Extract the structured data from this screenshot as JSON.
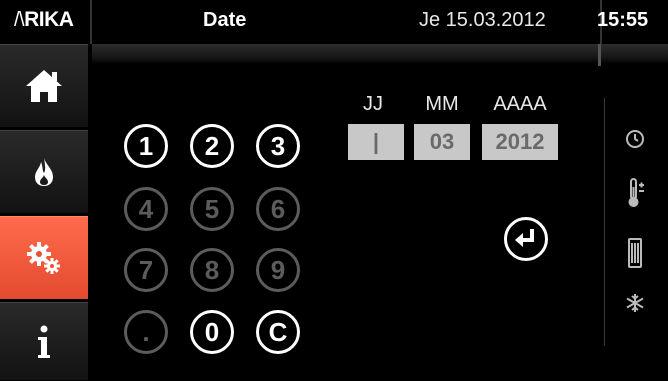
{
  "app": {
    "logo_text": "RIKA",
    "title": "Date",
    "date": "Je 15.03.2012",
    "time": "15:55"
  },
  "sidebar": {
    "items": [
      {
        "icon": "home-icon"
      },
      {
        "icon": "flame-icon"
      },
      {
        "icon": "settings-gears-icon",
        "active": true
      },
      {
        "icon": "info-icon"
      }
    ]
  },
  "keypad": {
    "keys": [
      {
        "label": "1",
        "enabled": true
      },
      {
        "label": "2",
        "enabled": true
      },
      {
        "label": "3",
        "enabled": true
      },
      {
        "label": "4",
        "enabled": false
      },
      {
        "label": "5",
        "enabled": false
      },
      {
        "label": "6",
        "enabled": false
      },
      {
        "label": "7",
        "enabled": false
      },
      {
        "label": "8",
        "enabled": false
      },
      {
        "label": "9",
        "enabled": false
      },
      {
        "label": ".",
        "enabled": false
      },
      {
        "label": "0",
        "enabled": true
      },
      {
        "label": "C",
        "enabled": true
      }
    ]
  },
  "date_fields": {
    "day": {
      "label": "JJ",
      "value": "|"
    },
    "month": {
      "label": "MM",
      "value": "03"
    },
    "year": {
      "label": "AAAA",
      "value": "2012"
    }
  },
  "status_icons": [
    "clock-icon",
    "thermometer-icon",
    "battery-icon",
    "snowflake-icon"
  ],
  "colors": {
    "accent": "#f05a3c",
    "background": "#000000",
    "field_bg": "#c8c8c8",
    "disabled": "#5c5c5c"
  }
}
